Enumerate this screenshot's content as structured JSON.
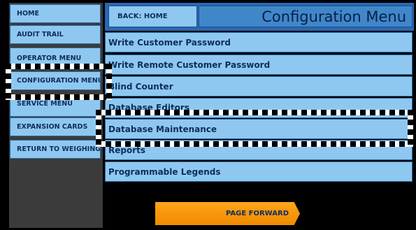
{
  "sidebar": {
    "items": [
      {
        "label": "HOME"
      },
      {
        "label": "AUDIT TRAIL"
      },
      {
        "label": "OPERATOR MENU"
      },
      {
        "label": "CONFIGURATION MENU"
      },
      {
        "label": "SERVICE MENU"
      },
      {
        "label": "EXPANSION CARDS"
      },
      {
        "label": "RETURN TO WEIGHING"
      }
    ]
  },
  "header": {
    "back_label": "BACK: HOME",
    "title": "Configuration Menu"
  },
  "menu": {
    "items": [
      {
        "label": "Write Customer Password"
      },
      {
        "label": "Write Remote Customer Password"
      },
      {
        "label": "Blind Counter"
      },
      {
        "label": "Database Editors"
      },
      {
        "label": "Database Maintenance"
      },
      {
        "label": "Reports"
      },
      {
        "label": "Programmable Legends"
      }
    ]
  },
  "footer": {
    "page_forward_label": "PAGE FORWARD"
  },
  "colors": {
    "button_blue": "#8ec8f0",
    "header_blue": "#2a67b3",
    "text_navy": "#0e2d5c",
    "accent_orange": "#f59a0c"
  }
}
